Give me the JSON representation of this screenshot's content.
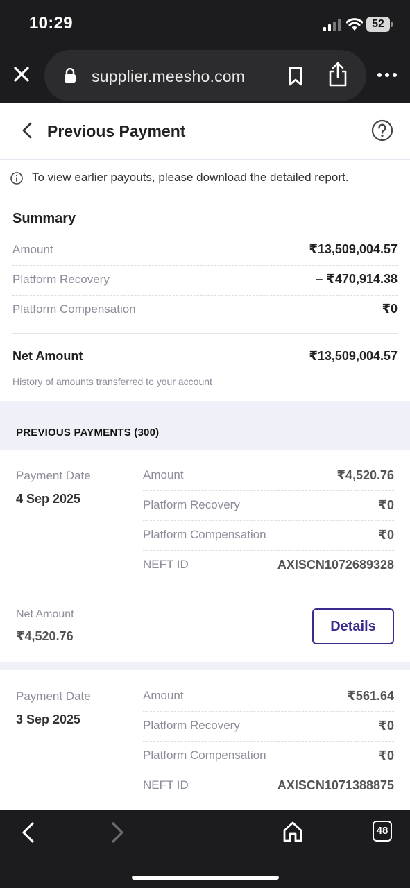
{
  "status_bar": {
    "time": "10:29",
    "battery": "52"
  },
  "browser": {
    "url": "supplier.meesho.com",
    "tab_count": "48"
  },
  "header": {
    "title": "Previous Payment"
  },
  "info_banner": {
    "text": "To view earlier payouts, please download the detailed report."
  },
  "summary": {
    "title": "Summary",
    "rows": [
      {
        "label": "Amount",
        "value": "₹13,509,004.57"
      },
      {
        "label": "Platform Recovery",
        "value": "– ₹470,914.38"
      },
      {
        "label": "Platform Compensation",
        "value": "₹0"
      }
    ],
    "net_label": "Net Amount",
    "net_value": "₹13,509,004.57",
    "history_note": "History of amounts transferred to your account"
  },
  "payments": {
    "section_title": "PREVIOUS PAYMENTS (300)",
    "items": [
      {
        "date_label": "Payment Date",
        "date": "4 Sep 2025",
        "rows": [
          {
            "label": "Amount",
            "value": "₹4,520.76"
          },
          {
            "label": "Platform Recovery",
            "value": "₹0"
          },
          {
            "label": "Platform Compensation",
            "value": "₹0"
          },
          {
            "label": "NEFT ID",
            "value": "AXISCN1072689328"
          }
        ],
        "net_label": "Net Amount",
        "net_value": "₹4,520.76",
        "details_label": "Details"
      },
      {
        "date_label": "Payment Date",
        "date": "3 Sep 2025",
        "rows": [
          {
            "label": "Amount",
            "value": "₹561.64"
          },
          {
            "label": "Platform Recovery",
            "value": "₹0"
          },
          {
            "label": "Platform Compensation",
            "value": "₹0"
          },
          {
            "label": "NEFT ID",
            "value": "AXISCN1071388875"
          }
        ]
      }
    ]
  },
  "colors": {
    "accent": "#3b2a8f",
    "chrome": "#1c1c1e",
    "band": "#eef1f7"
  }
}
